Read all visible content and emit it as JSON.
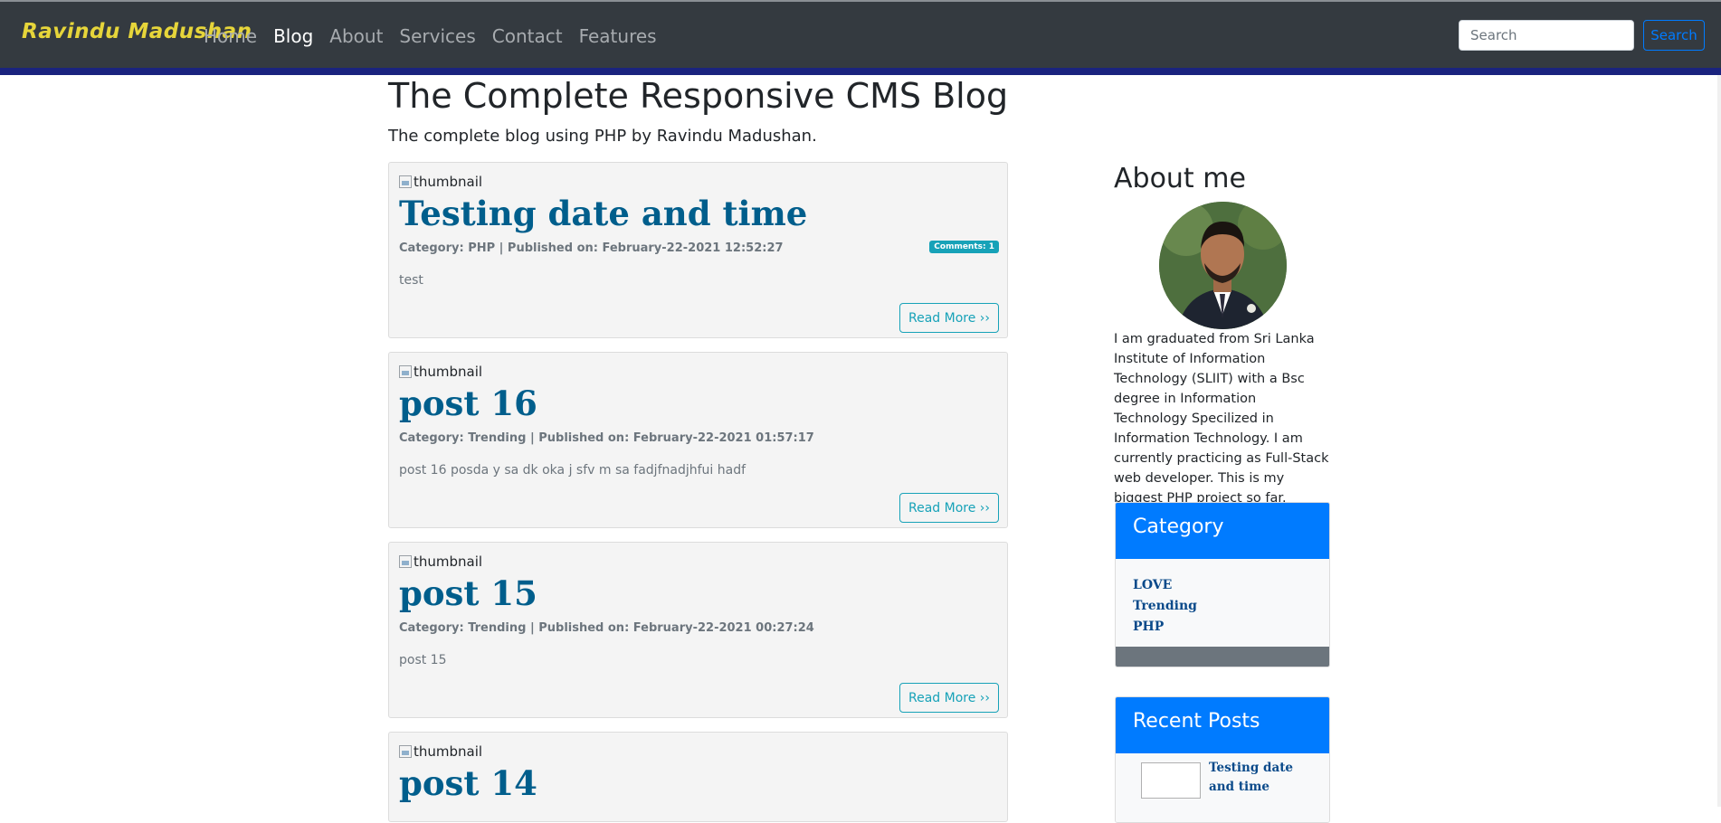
{
  "navbar": {
    "brand": "Ravindu Madushan",
    "links": [
      "Home",
      "Blog",
      "About",
      "Services",
      "Contact",
      "Features"
    ],
    "active": "Blog",
    "search_placeholder": "Search",
    "search_button": "Search"
  },
  "header": {
    "title": "The Complete Responsive CMS Blog",
    "subtitle": "The complete blog using PHP by Ravindu Madushan."
  },
  "posts": [
    {
      "thumb_alt": "thumbnail",
      "title": "Testing date and time",
      "meta": "Category: PHP | Published on: February-22-2021 12:52:27",
      "comments": "Comments: 1",
      "excerpt": "test",
      "read_more": "Read More ››"
    },
    {
      "thumb_alt": "thumbnail",
      "title": "post 16",
      "meta": "Category: Trending | Published on: February-22-2021 01:57:17",
      "excerpt": "post 16 posda y sa dk oka j sfv m sa fadjfnadjhfui hadf",
      "read_more": "Read More ››"
    },
    {
      "thumb_alt": "thumbnail",
      "title": "post 15",
      "meta": "Category: Trending | Published on: February-22-2021 00:27:24",
      "excerpt": "post 15",
      "read_more": "Read More ››"
    },
    {
      "thumb_alt": "thumbnail",
      "title": "post 14"
    }
  ],
  "sidebar": {
    "about_heading": "About me",
    "about_text": "I am graduated from Sri Lanka Institute of Information Technology (SLIIT) with a Bsc degree in Information Technology Specilized in Information Technology. I am currently practicing as Full-Stack web developer. This is my biggest PHP project so far.",
    "category_heading": "Category",
    "categories": [
      "LOVE",
      "Trending",
      "PHP"
    ],
    "recent_heading": "Recent Posts",
    "recent_posts": [
      "Testing date and time"
    ]
  },
  "colors": {
    "navbar_bg": "#343a40",
    "accent_bar": "#1a237e",
    "primary": "#007bff",
    "info": "#17a2b8",
    "post_title": "#005e8c"
  }
}
